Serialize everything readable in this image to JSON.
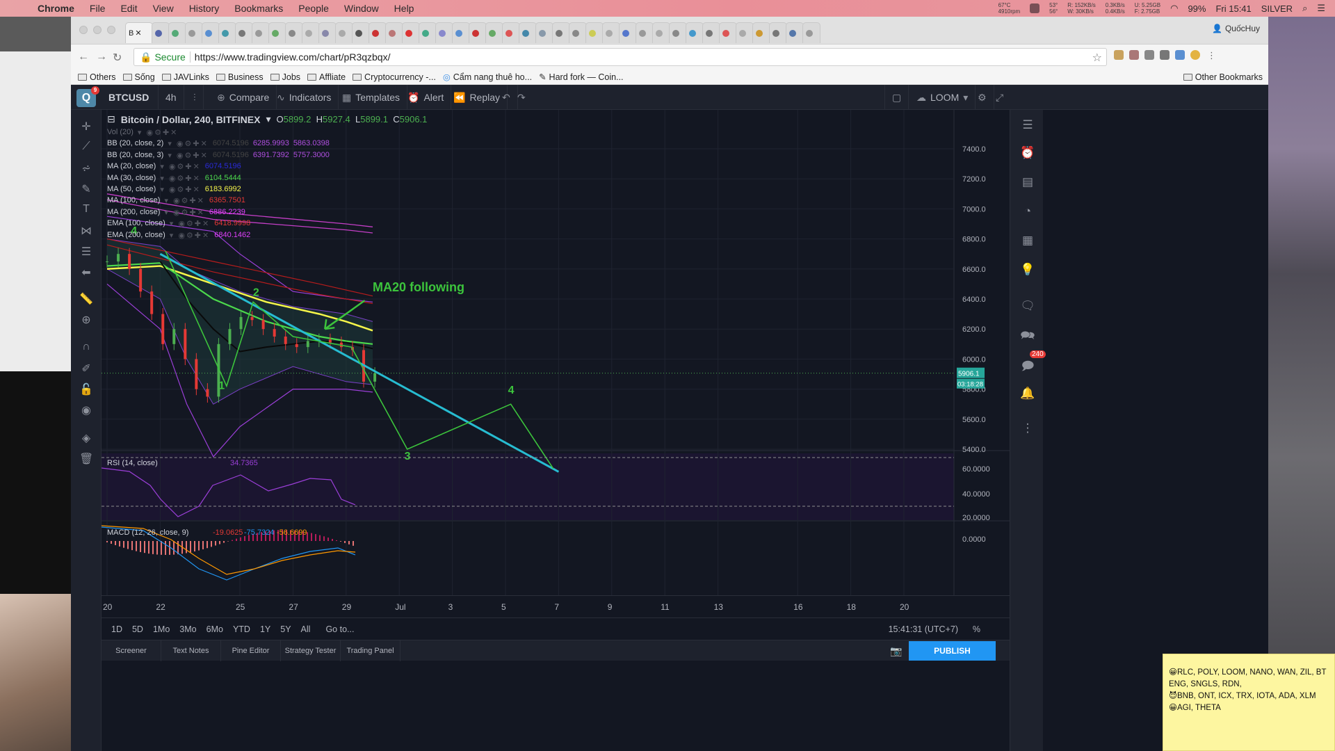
{
  "menubar": {
    "app": "Chrome",
    "items": [
      "File",
      "Edit",
      "View",
      "History",
      "Bookmarks",
      "People",
      "Window",
      "Help"
    ],
    "status": {
      "temp": "67°C",
      "rpm": "4910rpm",
      "cpu_temps": "53°\n56°",
      "net": "R: 152KB/s\nW: 30KB/s",
      "disk": "0.3KB/s\n0.4KB/s",
      "mem": "U: 5.25GB\nF: 2.75GB",
      "battery": "99%",
      "time": "Fri 15:41",
      "user": "SILVER"
    }
  },
  "browser": {
    "active_tab": "B",
    "profile": "QuốcHuy",
    "secure_label": "Secure",
    "url": "https://www.tradingview.com/chart/pR3qzbqx/",
    "bookmarks": [
      "Others",
      "Sống",
      "JAVLinks",
      "Business",
      "Jobs",
      "Affliate",
      "Cryptocurrency -...",
      "Cẩm nang thuê ho...",
      "Hard fork — Coin..."
    ],
    "other_bookmarks": "Other Bookmarks"
  },
  "tv": {
    "symbol": "BTCUSD",
    "interval": "4h",
    "compare": "Compare",
    "indicators": "Indicators",
    "templates": "Templates",
    "alert": "Alert",
    "replay": "Replay",
    "layout": "LOOM",
    "logo_badge": "9",
    "chat_badge": "240",
    "title": "Bitcoin / Dollar, 240, BITFINEX",
    "ohlc": {
      "o": "5899.2",
      "h": "5927.4",
      "l": "5899.1",
      "c": "5906.1"
    },
    "indicators_list": [
      {
        "name": "Vol (20)",
        "values": [],
        "colors": []
      },
      {
        "name": "BB (20, close, 2)",
        "values": [
          "6074.5196",
          "6285.9993",
          "5863.0398"
        ],
        "colors": [
          "#444444",
          "#b04fe0",
          "#b04fe0"
        ]
      },
      {
        "name": "BB (20, close, 3)",
        "values": [
          "6074.5196",
          "6391.7392",
          "5757.3000"
        ],
        "colors": [
          "#444444",
          "#b04fe0",
          "#b04fe0"
        ]
      },
      {
        "name": "MA (20, close)",
        "values": [
          "6074.5196"
        ],
        "colors": [
          "#2a2ad8"
        ]
      },
      {
        "name": "MA (30, close)",
        "values": [
          "6104.5444"
        ],
        "colors": [
          "#4cd94c"
        ]
      },
      {
        "name": "MA (50, close)",
        "values": [
          "6183.6992"
        ],
        "colors": [
          "#f5f54a"
        ]
      },
      {
        "name": "MA (100, close)",
        "values": [
          "6365.7501"
        ],
        "colors": [
          "#e53935"
        ]
      },
      {
        "name": "MA (200, close)",
        "values": [
          "6886.2239"
        ],
        "colors": [
          "#e040fb"
        ]
      },
      {
        "name": "EMA (100, close)",
        "values": [
          "6418.9998"
        ],
        "colors": [
          "#e53935"
        ]
      },
      {
        "name": "EMA (200, close)",
        "values": [
          "6840.1462"
        ],
        "colors": [
          "#e040fb"
        ]
      }
    ],
    "price_labels": [
      "7400.0",
      "7200.0",
      "7000.0",
      "6800.0",
      "6600.0",
      "6400.0",
      "6200.0",
      "6000.0",
      "5800.0",
      "5600.0",
      "5400.0"
    ],
    "last_price": "5906.1",
    "countdown": "03:18:28",
    "annotation": "MA20 following",
    "wave_labels": [
      "1",
      "2",
      "3",
      "4",
      "4"
    ],
    "rsi": {
      "label": "RSI (14, close)",
      "value": "34.7365",
      "scale": [
        "60.0000",
        "40.0000",
        "20.0000"
      ]
    },
    "macd": {
      "label": "MACD (12, 26, close, 9)",
      "values": [
        "-19.0625",
        "-75.7324",
        "-56.6699"
      ],
      "colors": [
        "#e53935",
        "#2196f3",
        "#ff9800"
      ],
      "scale": [
        "0.0000"
      ]
    },
    "time_labels": [
      "20",
      "22",
      "25",
      "27",
      "29",
      "Jul",
      "3",
      "5",
      "7",
      "9",
      "11",
      "13",
      "16",
      "18",
      "20"
    ],
    "ranges": [
      "1D",
      "5D",
      "1Mo",
      "3Mo",
      "6Mo",
      "YTD",
      "1Y",
      "5Y",
      "All",
      "Go to..."
    ],
    "clock": "15:41:31 (UTC+7)",
    "pct": "%",
    "bottom_tabs": [
      "Screener",
      "Text Notes",
      "Pine Editor",
      "Strategy Tester",
      "Trading Panel"
    ],
    "publish": "PUBLISH"
  },
  "chart_data": {
    "type": "candlestick",
    "title": "Bitcoin / Dollar, 240, BITFINEX",
    "x_labels": [
      "20",
      "22",
      "25",
      "27",
      "29",
      "Jul",
      "3",
      "5",
      "7"
    ],
    "ylim": [
      5250,
      7500
    ],
    "close_series": [
      6650,
      6700,
      6600,
      6450,
      6300,
      6100,
      6200,
      6000,
      5800,
      5750,
      6100,
      6200,
      6280,
      6260,
      6200,
      6150,
      6100,
      6080,
      6120,
      6130,
      6110,
      6080,
      6060,
      5850,
      5906
    ],
    "wave_path": [
      [
        "24",
        5800,
        "1"
      ],
      [
        "25.5",
        6350,
        "2"
      ],
      [
        "3",
        5390,
        "3"
      ],
      [
        "6",
        5700,
        "4"
      ],
      [
        "7.5",
        5250,
        ""
      ]
    ],
    "trendline": [
      [
        "22",
        6700
      ],
      [
        "7",
        5250
      ]
    ]
  },
  "sticky": {
    "lines": [
      "😀RLC, POLY, LOOM, NANO, WAN, ZIL, BT",
      "ENG, SNGLS, RDN,",
      "😈BNB, ONT, ICX, TRX, IOTA, ADA, XLM",
      "😀AGI, THETA"
    ]
  }
}
